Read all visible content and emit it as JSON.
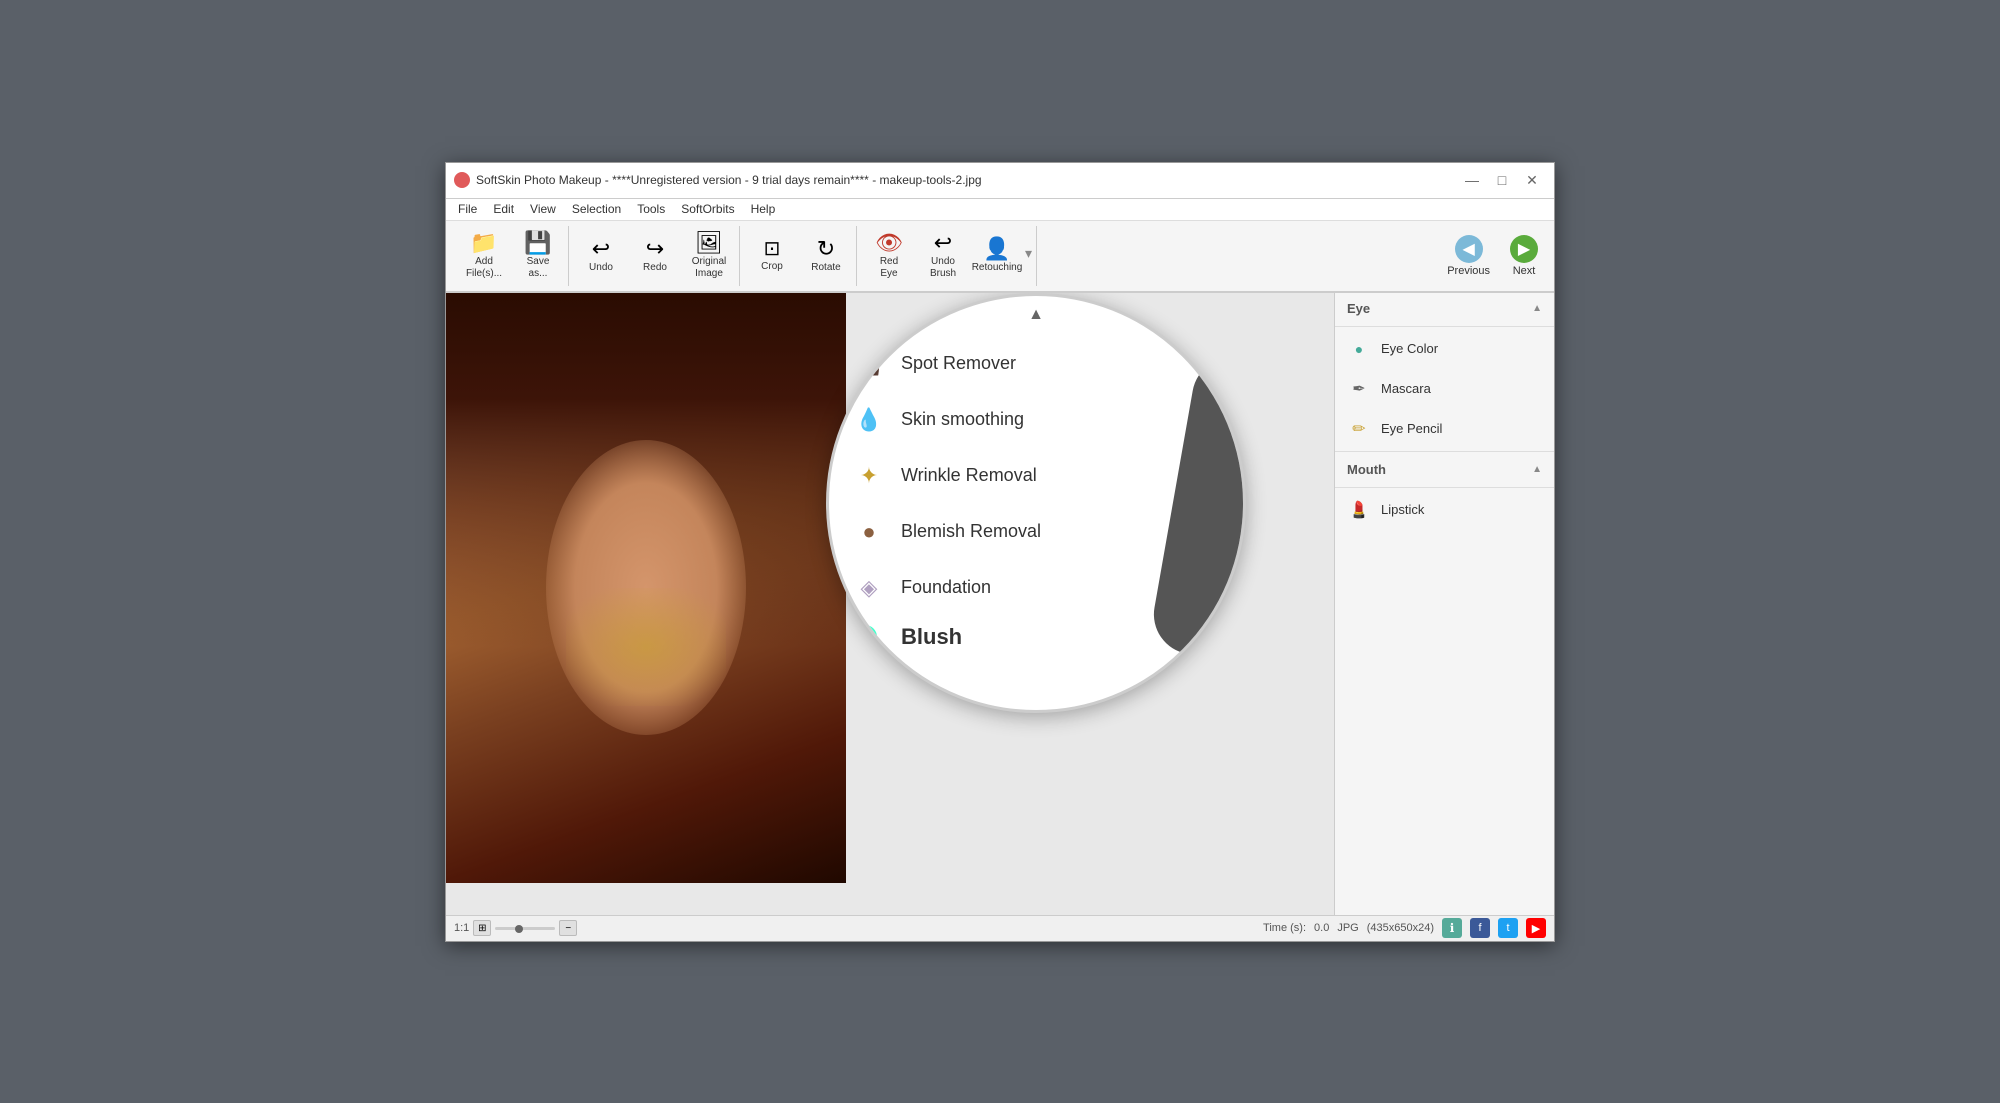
{
  "window": {
    "title": "SoftSkin Photo Makeup - ****Unregistered version - 9 trial days remain**** - makeup-tools-2.jpg",
    "icon_color": "#e05a5a"
  },
  "menu": {
    "items": [
      "File",
      "Edit",
      "View",
      "Selection",
      "Tools",
      "SoftOrbits",
      "Help"
    ]
  },
  "toolbar": {
    "buttons": [
      {
        "id": "add-files",
        "icon": "📁",
        "label": "Add\nFile(s)..."
      },
      {
        "id": "save-as",
        "icon": "💾",
        "label": "Save\nas..."
      },
      {
        "id": "undo",
        "icon": "↩",
        "label": "Undo"
      },
      {
        "id": "redo",
        "icon": "↪",
        "label": "Redo"
      },
      {
        "id": "original-image",
        "icon": "🖼",
        "label": "Original\nImage"
      },
      {
        "id": "crop",
        "icon": "⊡",
        "label": "Crop"
      },
      {
        "id": "rotate",
        "icon": "↻",
        "label": "Rotate"
      },
      {
        "id": "red-eye",
        "icon": "👁",
        "label": "Red\nEye"
      },
      {
        "id": "undo-brush",
        "icon": "↩",
        "label": "Undo\nBrush"
      },
      {
        "id": "retouching",
        "icon": "👤",
        "label": "Retouching"
      }
    ],
    "nav": {
      "previous_label": "Previous",
      "next_label": "Next"
    }
  },
  "zoom_menu": {
    "scroll_up": "▲",
    "close": "✕",
    "items": [
      {
        "id": "spot-remover",
        "icon": "👩",
        "label": "Spot Remover"
      },
      {
        "id": "skin-smoothing",
        "icon": "💧",
        "label": "Skin smoothing"
      },
      {
        "id": "wrinkle-removal",
        "icon": "🌟",
        "label": "Wrinkle Removal"
      },
      {
        "id": "blemish-removal",
        "icon": "🔵",
        "label": "Blemish Removal"
      },
      {
        "id": "foundation",
        "icon": "🎨",
        "label": "Foundation"
      }
    ],
    "partial_label": "Blush"
  },
  "right_panel": {
    "sections": [
      {
        "id": "eye",
        "label": "Eye",
        "items": [
          {
            "id": "eye-color",
            "icon": "🔵",
            "label": "Eye Color"
          },
          {
            "id": "mascara",
            "icon": "✏️",
            "label": "Mascara"
          },
          {
            "id": "eye-pencil",
            "icon": "✏️",
            "label": "Eye Pencil"
          }
        ]
      },
      {
        "id": "mouth",
        "label": "Mouth",
        "items": [
          {
            "id": "lipstick",
            "icon": "💄",
            "label": "Lipstick"
          }
        ]
      }
    ]
  },
  "status_bar": {
    "zoom_level": "1:1",
    "time_label": "Time (s):",
    "time_value": "0.0",
    "format": "JPG",
    "dimensions": "(435x650x24)"
  }
}
